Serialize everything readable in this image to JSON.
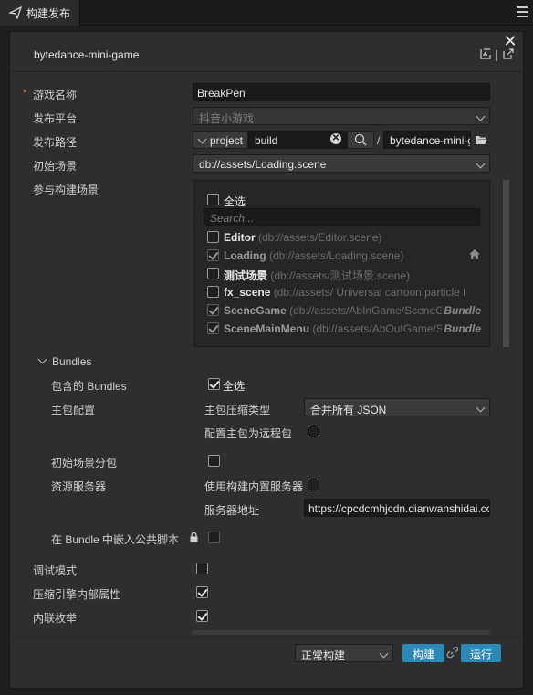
{
  "tab": {
    "label": "构建发布"
  },
  "header": {
    "title": "bytedance-mini-game"
  },
  "form": {
    "game_name": {
      "label": "游戏名称",
      "value": "BreakPen"
    },
    "platform": {
      "label": "发布平台",
      "value": "抖音小游戏"
    },
    "build_path": {
      "label": "发布路径",
      "prefix": "project",
      "folder": "build",
      "separator": "/",
      "output": "bytedance-mini-g"
    },
    "start_scene": {
      "label": "初始场景",
      "value": "db://assets/Loading.scene"
    },
    "included_scenes": {
      "label": "参与构建场景",
      "select_all": "全选",
      "search_placeholder": "Search...",
      "items": [
        {
          "name": "Editor",
          "path": "(db://assets/Editor.scene)",
          "checked": false,
          "bundle": ""
        },
        {
          "name": "Loading",
          "path": "(db://assets/Loading.scene)",
          "checked": true,
          "bundle": ""
        },
        {
          "name": "测试场景",
          "path": "(db://assets/测试场景.scene)",
          "checked": false,
          "bundle": ""
        },
        {
          "name": "fx_scene",
          "path": "(db://assets/ Universal cartoon particle l",
          "checked": false,
          "bundle": ""
        },
        {
          "name": "SceneGame",
          "path": "(db://assets/AbInGame/SceneG",
          "checked": true,
          "bundle": "Bundle"
        },
        {
          "name": "SceneMainMenu",
          "path": "(db://assets/AbOutGame/Su",
          "checked": true,
          "bundle": "Bundle"
        }
      ]
    },
    "bundles": {
      "label": "Bundles",
      "included_label": "包含的 Bundles",
      "included_all": "全选",
      "main_config_label": "主包配置",
      "compression_label": "主包压缩类型",
      "compression_value": "合并所有 JSON",
      "remote_label": "配置主包为远程包",
      "start_scene_subpackage": "初始场景分包",
      "resource_server": "资源服务器",
      "use_builtin_server": "使用构建内置服务器",
      "server_address_label": "服务器地址",
      "server_address_value": "https://cpcdcmhjcdn.dianwanshidai.cc",
      "embed_common_script": "在 Bundle 中嵌入公共脚本"
    },
    "debug_mode": "调试模式",
    "mangle_properties": "压缩引擎内部属性",
    "inline_enum": "内联枚举"
  },
  "footer": {
    "build_mode": "正常构建",
    "build_button": "构建",
    "run_button": "运行"
  }
}
